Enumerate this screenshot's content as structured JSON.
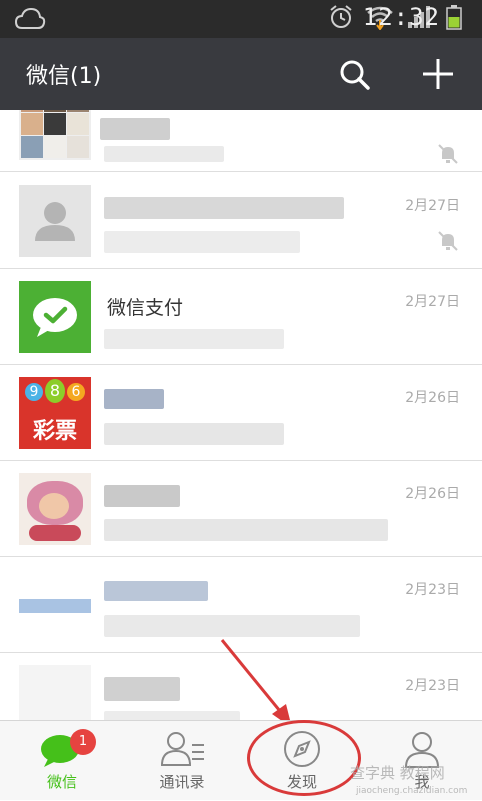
{
  "status_bar": {
    "time": "12:32"
  },
  "header": {
    "title": "微信(1)"
  },
  "chats": [
    {
      "name": "",
      "preview": "",
      "time": "",
      "muted": true
    },
    {
      "name": "",
      "preview": "",
      "time": "2月27日",
      "muted": true
    },
    {
      "name": "微信支付",
      "preview": "",
      "time": "2月27日",
      "muted": false
    },
    {
      "name": "",
      "preview": "",
      "time": "2月26日",
      "muted": false
    },
    {
      "name": "",
      "preview": "",
      "time": "2月26日",
      "muted": false
    },
    {
      "name": "",
      "preview": "",
      "time": "2月23日",
      "muted": false
    },
    {
      "name": "",
      "preview": "",
      "time": "2月23日",
      "muted": false
    }
  ],
  "lottery_avatar": {
    "digits": [
      "9",
      "8",
      "6"
    ],
    "label": "彩票"
  },
  "tabs": [
    {
      "label": "微信",
      "active": true,
      "badge": "1"
    },
    {
      "label": "通讯录",
      "active": false
    },
    {
      "label": "发现",
      "active": false
    },
    {
      "label": "我",
      "active": false
    }
  ],
  "watermark": {
    "line1": "查字典 教程网",
    "line2": "jiaocheng.chazidian.com"
  },
  "colors": {
    "accent_green": "#45c01a",
    "titlebar": "#393a3f",
    "badge_red": "#e64340",
    "annotation_red": "#d93a3a"
  }
}
